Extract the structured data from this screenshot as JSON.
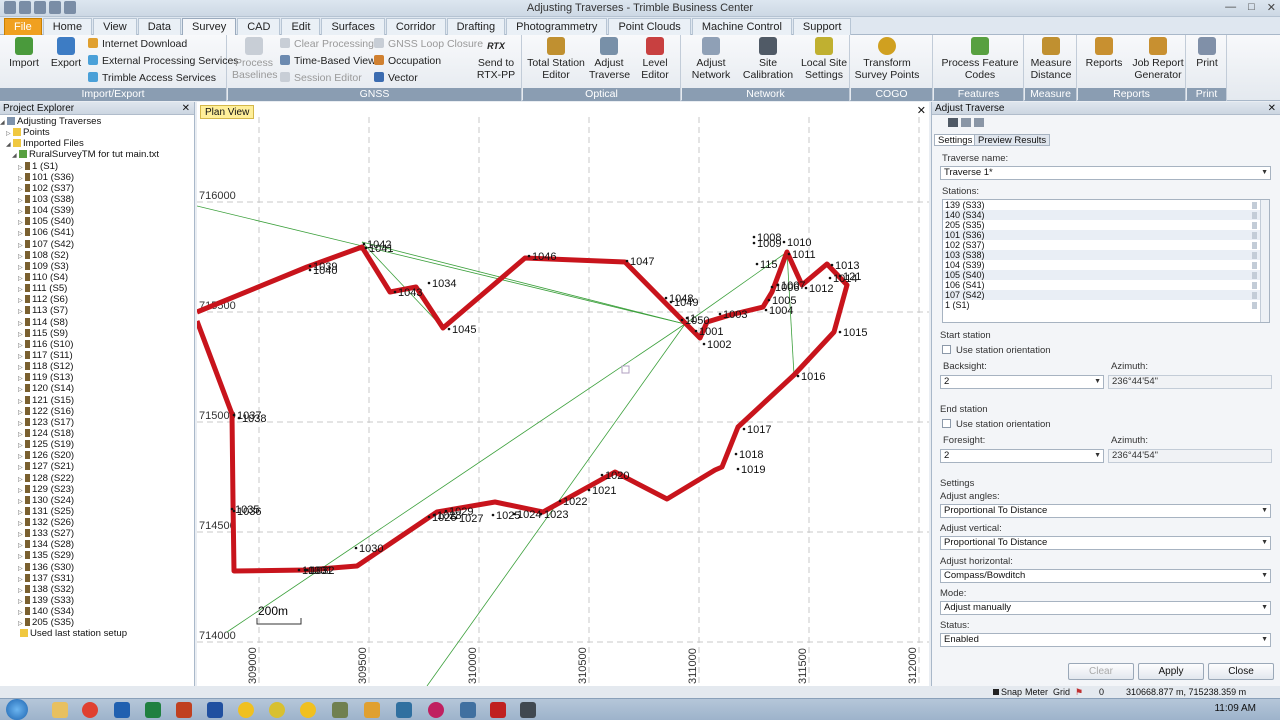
{
  "window": {
    "title": "Adjusting Traverses - Trimble Business Center",
    "controls": [
      "—",
      "□",
      "✕"
    ]
  },
  "tabs": [
    "File",
    "Home",
    "View",
    "Data",
    "Survey",
    "CAD",
    "Edit",
    "Surfaces",
    "Corridor",
    "Drafting",
    "Photogrammetry",
    "Point Clouds",
    "Machine Control",
    "Support"
  ],
  "active_tab": "Survey",
  "ribbon": {
    "import_export": {
      "label": "Import/Export",
      "import": "Import",
      "export": "Export",
      "internet_download": "Internet Download",
      "external_processing": "External Processing Services",
      "trimble_access": "Trimble Access Services"
    },
    "gnss": {
      "label": "GNSS",
      "process_baselines_1": "Process",
      "process_baselines_2": "Baselines",
      "clear_processing": "Clear Processing",
      "time_based_view": "Time-Based View",
      "session_editor": "Session Editor",
      "gnss_loop_closure": "GNSS Loop Closure",
      "occupation": "Occupation",
      "vector": "Vector",
      "send_to_1": "Send to",
      "send_to_2": "RTX-PP",
      "rtx": "RTX"
    },
    "optical": {
      "label": "Optical",
      "tse_1": "Total Station",
      "tse_2": "Editor",
      "adjust_traverse_1": "Adjust",
      "adjust_traverse_2": "Traverse",
      "level_editor_1": "Level",
      "level_editor_2": "Editor"
    },
    "network": {
      "label": "Network",
      "adjust_network_1": "Adjust",
      "adjust_network_2": "Network",
      "site_cal_1": "Site",
      "site_cal_2": "Calibration",
      "local_site_1": "Local Site",
      "local_site_2": "Settings"
    },
    "cogo": {
      "label": "COGO",
      "transform_1": "Transform",
      "transform_2": "Survey Points"
    },
    "features": {
      "label": "Features",
      "pfc_1": "Process Feature",
      "pfc_2": "Codes"
    },
    "measure": {
      "label": "Measure",
      "md_1": "Measure",
      "md_2": "Distance"
    },
    "reports": {
      "label": "Reports",
      "reports": "Reports",
      "jrg_1": "Job Report",
      "jrg_2": "Generator"
    },
    "print": {
      "label": "Print",
      "print": "Print"
    }
  },
  "project_explorer": {
    "title": "Project Explorer",
    "root": "Adjusting Traverses",
    "points": "Points",
    "imported_files": "Imported Files",
    "file": "RuralSurveyTM for tut main.txt",
    "items": [
      "1 (S1)",
      "101 (S36)",
      "102 (S37)",
      "103 (S38)",
      "104 (S39)",
      "105 (S40)",
      "106 (S41)",
      "107 (S42)",
      "108 (S2)",
      "109 (S3)",
      "110 (S4)",
      "111 (S5)",
      "112 (S6)",
      "113 (S7)",
      "114 (S8)",
      "115 (S9)",
      "116 (S10)",
      "117 (S11)",
      "118 (S12)",
      "119 (S13)",
      "120 (S14)",
      "121 (S15)",
      "122 (S16)",
      "123 (S17)",
      "124 (S18)",
      "125 (S19)",
      "126 (S20)",
      "127 (S21)",
      "128 (S22)",
      "129 (S23)",
      "130 (S24)",
      "131 (S25)",
      "132 (S26)",
      "133 (S27)",
      "134 (S28)",
      "135 (S29)",
      "136 (S30)",
      "137 (S31)",
      "138 (S32)",
      "139 (S33)",
      "140 (S34)",
      "205 (S35)"
    ],
    "last": "Used last station setup"
  },
  "plan_view": {
    "tab": "Plan View",
    "northing": [
      "716000",
      "715500",
      "715000",
      "714500",
      "714000"
    ],
    "easting": [
      "309000",
      "309500",
      "310000",
      "310500",
      "311000",
      "311500",
      "312000"
    ],
    "scale": "200m",
    "labels": [
      "1042",
      "1041",
      "1039",
      "1040",
      "1043",
      "1034",
      "1045",
      "1046",
      "1047",
      "1048",
      "1049",
      "1050",
      "1",
      "1001",
      "1002",
      "1003",
      "1004",
      "1005",
      "1006",
      "1007",
      "1008",
      "1009",
      "1010",
      "1011",
      "1012",
      "1013",
      "1014",
      "1015",
      "1016",
      "1017",
      "1018",
      "1019",
      "1020",
      "1021",
      "1022",
      "1023",
      "1024",
      "1025",
      "1026",
      "1027",
      "1028",
      "1029",
      "1030",
      "1031",
      "1032",
      "1033",
      "1035",
      "1036",
      "1037",
      "1038",
      "121",
      "115"
    ]
  },
  "adjust_traverse": {
    "title": "Adjust Traverse",
    "tab_settings": "Settings",
    "tab_preview": "Preview Results",
    "traverse_name_label": "Traverse name:",
    "traverse_name": "Traverse 1*",
    "stations_label": "Stations:",
    "stations": [
      "139 (S33)",
      "140 (S34)",
      "205 (S35)",
      "101 (S36)",
      "102 (S37)",
      "103 (S38)",
      "104 (S39)",
      "105 (S40)",
      "106 (S41)",
      "107 (S42)",
      "1 (S1)"
    ],
    "start_station": "Start station",
    "use_orientation": "Use station orientation",
    "backsight_label": "Backsight:",
    "backsight": "2",
    "azimuth_label": "Azimuth:",
    "start_azimuth": "236°44'54\"",
    "end_station": "End station",
    "foresight_label": "Foresight:",
    "foresight": "2",
    "end_azimuth": "236°44'54\"",
    "settings": "Settings",
    "adjust_angles_label": "Adjust angles:",
    "adjust_angles": "Proportional To Distance",
    "adjust_vertical_label": "Adjust vertical:",
    "adjust_vertical": "Proportional To Distance",
    "adjust_horizontal_label": "Adjust horizontal:",
    "adjust_horizontal": "Compass/Bowditch",
    "mode_label": "Mode:",
    "mode": "Adjust manually",
    "status_label": "Status:",
    "status": "Enabled",
    "clear": "Clear",
    "apply": "Apply",
    "close": "Close"
  },
  "statusbar": {
    "snap": "Snap",
    "meter": "Meter",
    "grid": "Grid",
    "zero": "0",
    "coords": "310668.877 m, 715238.359 m"
  },
  "taskbar": {
    "time": "11:09 AM"
  },
  "colors": {
    "traverse": "#c8141c",
    "accent": "#f0a020",
    "ribbon_label": "#8a9db2"
  }
}
